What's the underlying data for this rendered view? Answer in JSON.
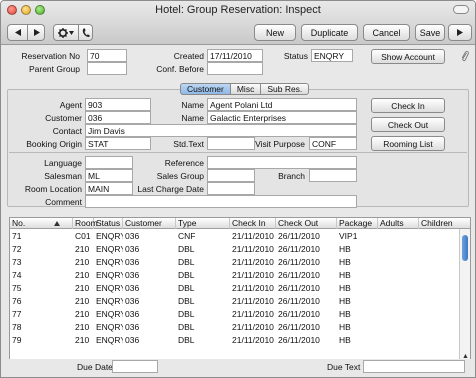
{
  "window": {
    "title": "Hotel: Group Reservation: Inspect",
    "buttons": {
      "new": "New",
      "duplicate": "Duplicate",
      "cancel": "Cancel",
      "save": "Save"
    }
  },
  "header": {
    "reservation_no_label": "Reservation No",
    "reservation_no": "70",
    "created_label": "Created",
    "created": "17/11/2010",
    "status_label": "Status",
    "status": "ENQRY",
    "show_account": "Show Account",
    "parent_group_label": "Parent Group",
    "parent_group": "",
    "conf_before_label": "Conf. Before",
    "conf_before": ""
  },
  "tabs": [
    {
      "label": "Customer",
      "active": true
    },
    {
      "label": "Misc",
      "active": false
    },
    {
      "label": "Sub Res.",
      "active": false
    }
  ],
  "customer": {
    "agent_label": "Agent",
    "agent": "903",
    "agent_name_label": "Name",
    "agent_name": "Agent Polani Ltd",
    "customer_label": "Customer",
    "customer": "036",
    "customer_name_label": "Name",
    "customer_name": "Galactic Enterprises",
    "contact_label": "Contact",
    "contact": "Jim Davis",
    "booking_origin_label": "Booking Origin",
    "booking_origin": "STAT",
    "std_text_label": "Std.Text",
    "std_text": "",
    "visit_purpose_label": "Visit Purpose",
    "visit_purpose": "CONF",
    "check_in_button": "Check In",
    "check_out_button": "Check Out",
    "rooming_list_button": "Rooming List",
    "language_label": "Language",
    "language": "",
    "reference_label": "Reference",
    "reference": "",
    "salesman_label": "Salesman",
    "salesman": "ML",
    "sales_group_label": "Sales Group",
    "sales_group": "",
    "branch_label": "Branch",
    "branch": "",
    "room_location_label": "Room Location",
    "room_location": "MAIN",
    "last_charge_date_label": "Last Charge Date",
    "last_charge_date": "",
    "comment_label": "Comment",
    "comment": ""
  },
  "table": {
    "columns": [
      "No.",
      "Room",
      "Status",
      "Customer",
      "Type",
      "Check In",
      "Check Out",
      "Package",
      "Adults",
      "Children"
    ],
    "rows": [
      [
        "71",
        "C01",
        "ENQRY",
        "036",
        "CNF",
        "21/11/2010",
        "26/11/2010",
        "VIP1",
        "",
        ""
      ],
      [
        "72",
        "210",
        "ENQRY",
        "036",
        "DBL",
        "21/11/2010",
        "26/11/2010",
        "HB",
        "",
        ""
      ],
      [
        "73",
        "210",
        "ENQRY",
        "036",
        "DBL",
        "21/11/2010",
        "26/11/2010",
        "HB",
        "",
        ""
      ],
      [
        "74",
        "210",
        "ENQRY",
        "036",
        "DBL",
        "21/11/2010",
        "26/11/2010",
        "HB",
        "",
        ""
      ],
      [
        "75",
        "210",
        "ENQRY",
        "036",
        "DBL",
        "21/11/2010",
        "26/11/2010",
        "HB",
        "",
        ""
      ],
      [
        "76",
        "210",
        "ENQRY",
        "036",
        "DBL",
        "21/11/2010",
        "26/11/2010",
        "HB",
        "",
        ""
      ],
      [
        "77",
        "210",
        "ENQRY",
        "036",
        "DBL",
        "21/11/2010",
        "26/11/2010",
        "HB",
        "",
        ""
      ],
      [
        "78",
        "210",
        "ENQRY",
        "036",
        "DBL",
        "21/11/2010",
        "26/11/2010",
        "HB",
        "",
        ""
      ],
      [
        "79",
        "210",
        "ENQRY",
        "036",
        "DBL",
        "21/11/2010",
        "26/11/2010",
        "HB",
        "",
        ""
      ]
    ]
  },
  "footer": {
    "due_date_label": "Due Date",
    "due_date": "",
    "due_text_label": "Due Text",
    "due_text": ""
  }
}
